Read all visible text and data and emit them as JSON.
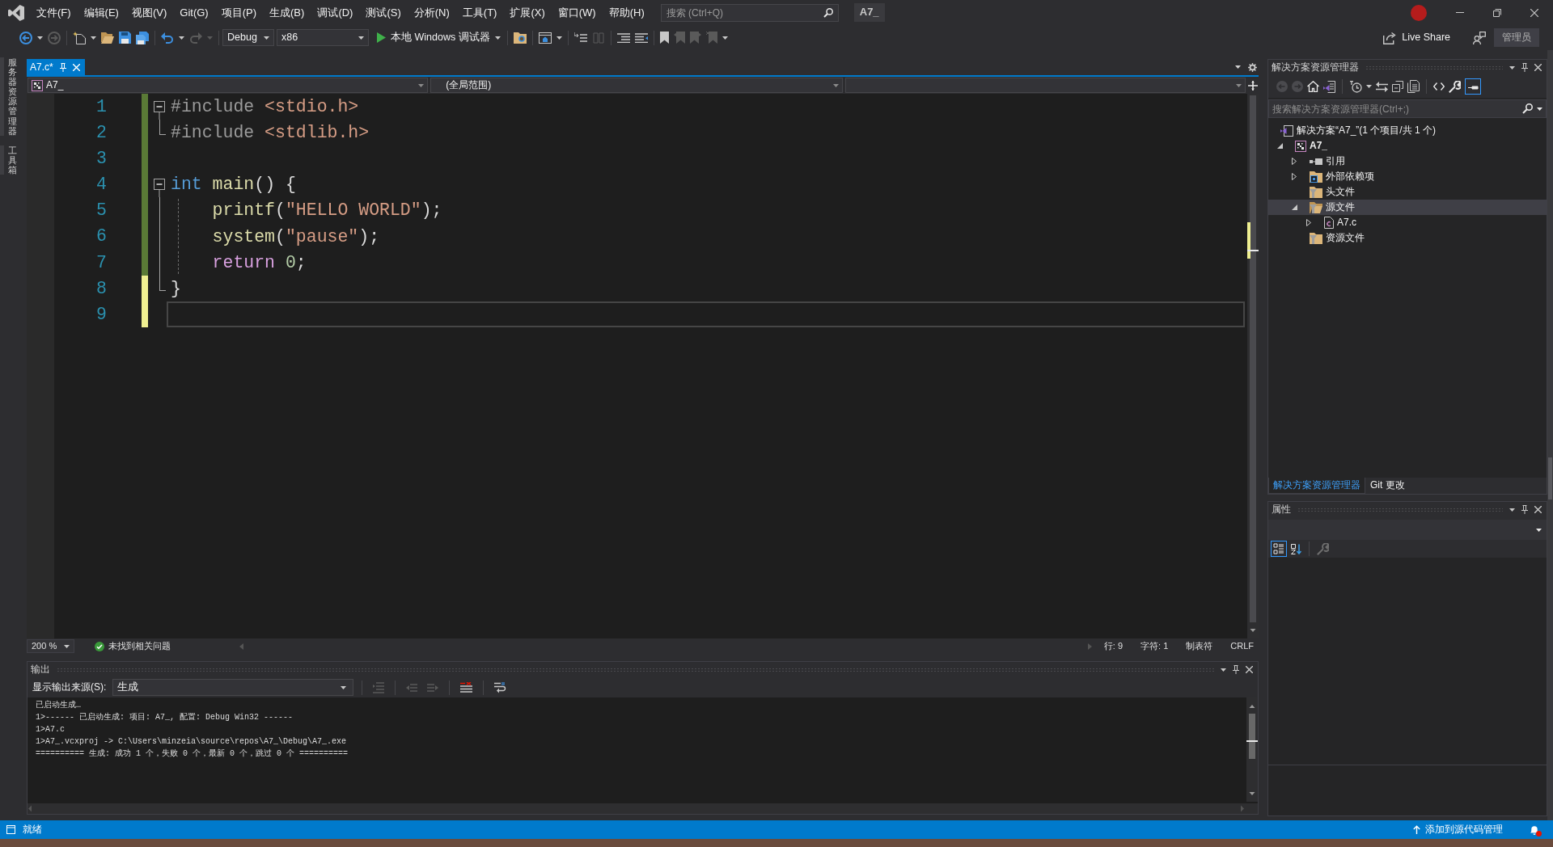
{
  "title_bar": {
    "menu": [
      "文件(F)",
      "编辑(E)",
      "视图(V)",
      "Git(G)",
      "项目(P)",
      "生成(B)",
      "调试(D)",
      "测试(S)",
      "分析(N)",
      "工具(T)",
      "扩展(X)",
      "窗口(W)",
      "帮助(H)"
    ],
    "search": {
      "placeholder": "搜索 (Ctrl+Q)"
    },
    "solution_name": "A7_"
  },
  "toolbar": {
    "configuration": "Debug",
    "platform": "x86",
    "start": "本地 Windows 调试器",
    "live_share": "Live Share",
    "account": "管理员"
  },
  "side_tabs": [
    "服务器资源管理器",
    "工具箱"
  ],
  "editor": {
    "tabs": [
      {
        "label": "A7.c*",
        "selected": true
      }
    ],
    "navigation": {
      "project": "A7_",
      "scope": "(全局范围)"
    },
    "lines": [
      {
        "number": "1",
        "saved": true,
        "fold_start": true,
        "fold_guide": false,
        "fold_end": false,
        "indented": false,
        "current": false,
        "tokens": [
          {
            "kind": "directive",
            "text": "#include"
          },
          {
            "kind": "path",
            "text": " <stdio.h>"
          }
        ]
      },
      {
        "number": "2",
        "saved": true,
        "fold_start": false,
        "fold_guide": false,
        "fold_end": true,
        "indented": false,
        "current": false,
        "tokens": [
          {
            "kind": "directive",
            "text": "#include"
          },
          {
            "kind": "path",
            "text": " <stdlib.h>"
          }
        ]
      },
      {
        "number": "3",
        "saved": true,
        "fold_start": false,
        "fold_guide": false,
        "fold_end": false,
        "indented": false,
        "current": false
      },
      {
        "number": "4",
        "saved": true,
        "fold_start": true,
        "fold_guide": false,
        "fold_end": false,
        "indented": false,
        "current": false,
        "tokens": [
          {
            "kind": "keyword",
            "text": "int"
          },
          {
            "kind": "function",
            "text": " main"
          },
          {
            "kind": "plain",
            "text": "() {"
          }
        ]
      },
      {
        "number": "5",
        "saved": true,
        "fold_start": false,
        "fold_guide": true,
        "fold_end": false,
        "indented": true,
        "current": false,
        "tokens": [
          {
            "kind": "function",
            "text": "printf"
          },
          {
            "kind": "plain",
            "text": "("
          },
          {
            "kind": "string",
            "text": "\"HELLO WORLD\""
          },
          {
            "kind": "plain",
            "text": ");"
          }
        ]
      },
      {
        "number": "6",
        "saved": true,
        "fold_start": false,
        "fold_guide": true,
        "fold_end": false,
        "indented": true,
        "current": false,
        "tokens": [
          {
            "kind": "function",
            "text": "system"
          },
          {
            "kind": "plain",
            "text": "("
          },
          {
            "kind": "string",
            "text": "\"pause\""
          },
          {
            "kind": "plain",
            "text": ");"
          }
        ]
      },
      {
        "number": "7",
        "saved": true,
        "fold_start": false,
        "fold_guide": true,
        "fold_end": false,
        "indented": true,
        "current": false,
        "tokens": [
          {
            "kind": "control",
            "text": "return"
          },
          {
            "kind": "number",
            "text": " 0"
          },
          {
            "kind": "plain",
            "text": ";"
          }
        ]
      },
      {
        "number": "8",
        "saved": false,
        "fold_start": false,
        "fold_guide": false,
        "fold_end": true,
        "indented": false,
        "current": false,
        "tokens": [
          {
            "kind": "plain",
            "text": "}"
          }
        ]
      },
      {
        "number": "9",
        "saved": false,
        "fold_start": false,
        "fold_guide": false,
        "fold_end": false,
        "indented": false,
        "current": true
      }
    ],
    "status": {
      "zoom": "200 %",
      "issues": "未找到相关问题",
      "line": "行: 9",
      "column": "字符: 1",
      "indent": "制表符",
      "line_ending": "CRLF"
    }
  },
  "output": {
    "title": "输出",
    "source_label": "显示输出来源(S):",
    "source": "生成",
    "lines": [
      "已启动生成…",
      "1>------ 已启动生成: 项目: A7_, 配置: Debug Win32 ------",
      "1>A7.c",
      "1>A7_.vcxproj -> C:\\Users\\minzeia\\source\\repos\\A7_\\Debug\\A7_.exe",
      "========== 生成: 成功 1 个，失败 0 个，最新 0 个，跳过 0 个 =========="
    ]
  },
  "solution_explorer": {
    "title": "解决方案资源管理器",
    "preview_selected": true,
    "search": {
      "placeholder": "搜索解决方案资源管理器(Ctrl+;)"
    },
    "tree": [
      {
        "label": "解决方案“A7_”(1 个项目/共 1 个)",
        "kind": "solution",
        "selected": false,
        "children": [
          {
            "label": "A7_",
            "kind": "project",
            "expanded": true,
            "selected": false,
            "children": [
              {
                "label": "引用",
                "kind": "references",
                "expanded": false,
                "selected": false
              },
              {
                "label": "外部依赖项",
                "kind": "dependencies",
                "expanded": false,
                "selected": false
              },
              {
                "label": "头文件",
                "kind": "filter",
                "selected": false
              },
              {
                "label": "源文件",
                "kind": "filter",
                "expanded": true,
                "selected": true,
                "children": [
                  {
                    "label": "A7.c",
                    "kind": "source",
                    "expanded": false,
                    "selected": false
                  }
                ]
              },
              {
                "label": "资源文件",
                "kind": "filter",
                "selected": false
              }
            ]
          }
        ]
      }
    ],
    "tabs": [
      {
        "label": "解决方案资源管理器",
        "selected": true
      },
      {
        "label": "Git 更改",
        "selected": false
      }
    ]
  },
  "properties": {
    "title": "属性",
    "sort": {
      "categorized": true,
      "alphabetical": false
    }
  },
  "status_bar": {
    "message": "就绪",
    "source_control": "添加到源代码管理"
  }
}
